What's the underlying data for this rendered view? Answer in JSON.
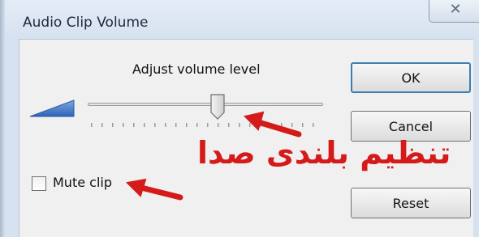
{
  "window": {
    "title": "Audio Clip Volume",
    "close_glyph": "✕"
  },
  "volume": {
    "label": "Adjust volume level",
    "level": 0.54,
    "icon": "volume-wedge-icon"
  },
  "buttons": {
    "ok": "OK",
    "cancel": "Cancel",
    "reset": "Reset"
  },
  "mute": {
    "label": "Mute clip",
    "checked": false
  },
  "annotation": {
    "text": "تنظیم بلندی صدا",
    "color": "#d51a1a"
  }
}
